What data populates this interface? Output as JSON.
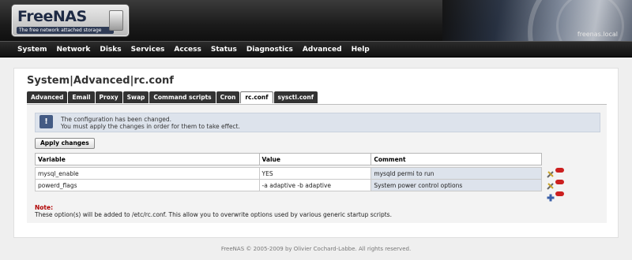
{
  "logo": {
    "title": "FreeNAS",
    "tagline": "The free network attached storage"
  },
  "hostname": "freenas.local",
  "nav": [
    "System",
    "Network",
    "Disks",
    "Services",
    "Access",
    "Status",
    "Diagnostics",
    "Advanced",
    "Help"
  ],
  "page_title": "System|Advanced|rc.conf",
  "tabs": [
    "Advanced",
    "Email",
    "Proxy",
    "Swap",
    "Command scripts",
    "Cron",
    "rc.conf",
    "sysctl.conf"
  ],
  "active_tab": "rc.conf",
  "notice": {
    "line1": "The configuration has been changed.",
    "line2": "You must apply the changes in order for them to take effect."
  },
  "apply_label": "Apply changes",
  "table": {
    "headers": [
      "Variable",
      "Value",
      "Comment"
    ],
    "rows": [
      {
        "variable": "mysql_enable",
        "value": "YES",
        "comment": "mysqld permi to run"
      },
      {
        "variable": "powerd_flags",
        "value": "-a adaptive -b adaptive",
        "comment": "System power control options"
      }
    ]
  },
  "note": {
    "label": "Note:",
    "text": "These option(s) will be added to /etc/rc.conf. This allow you to overwrite options used by various generic startup scripts."
  },
  "footer": "FreeNAS © 2005-2009 by Olivier Cochard-Labbe. All rights reserved.",
  "colors": {
    "nav_bg": "#1b1b1b",
    "notice_bg": "#dde3ec",
    "delete_red": "#cc1f1f",
    "add_blue": "#3a5fa8",
    "note_red": "#b00000"
  },
  "icons": {
    "notice": "info-icon",
    "edit": "edit-icon",
    "delete": "delete-icon",
    "add": "add-icon"
  }
}
